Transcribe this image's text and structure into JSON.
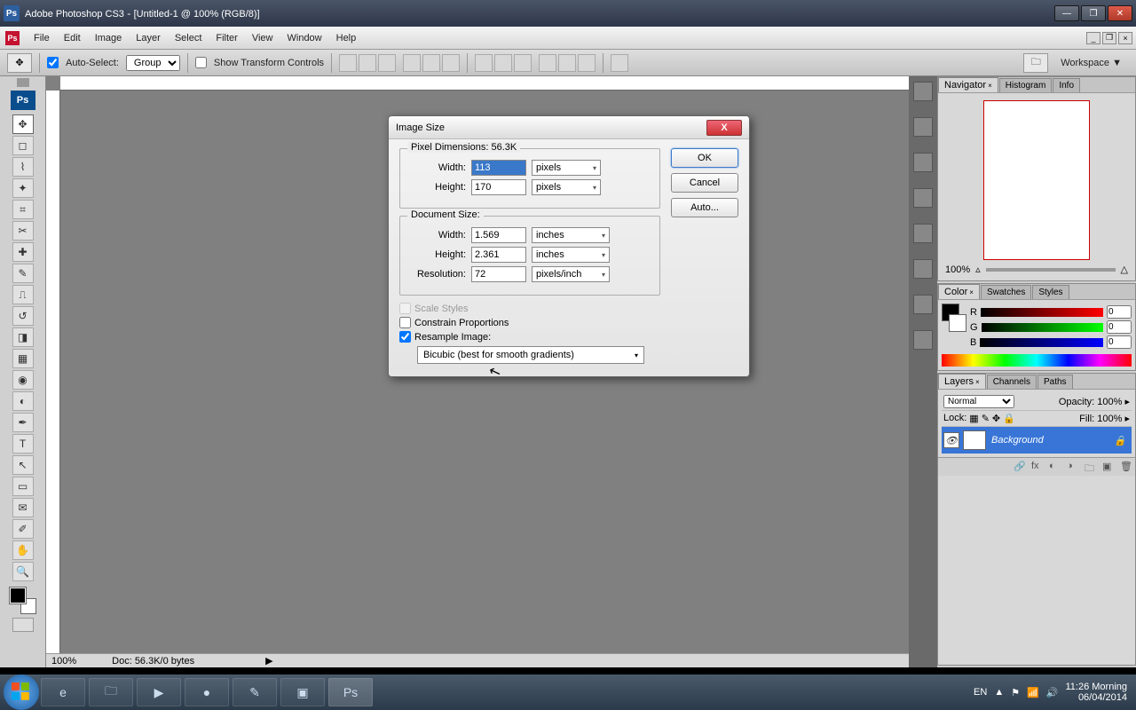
{
  "titlebar": {
    "app": "Adobe Photoshop CS3",
    "doc": "[Untitled-1 @ 100% (RGB/8)]"
  },
  "menu": [
    "File",
    "Edit",
    "Image",
    "Layer",
    "Select",
    "Filter",
    "View",
    "Window",
    "Help"
  ],
  "options": {
    "auto_select": "Auto-Select:",
    "group": "Group",
    "show_transform": "Show Transform Controls",
    "workspace": "Workspace"
  },
  "status": {
    "zoom": "100%",
    "doc": "Doc: 56.3K/0 bytes"
  },
  "dialog": {
    "title": "Image Size",
    "pixel_legend": "Pixel Dimensions:  56.3K",
    "width_l": "Width:",
    "height_l": "Height:",
    "res_l": "Resolution:",
    "px_w": "113",
    "px_h": "170",
    "px_unit": "pixels",
    "doc_legend": "Document Size:",
    "doc_w": "1.569",
    "doc_h": "2.361",
    "doc_unit": "inches",
    "res": "72",
    "res_unit": "pixels/inch",
    "scale": "Scale Styles",
    "constrain": "Constrain Proportions",
    "resample": "Resample Image:",
    "method": "Bicubic (best for smooth gradients)",
    "ok": "OK",
    "cancel": "Cancel",
    "auto": "Auto..."
  },
  "nav": {
    "tab1": "Navigator",
    "tab2": "Histogram",
    "tab3": "Info",
    "zoom": "100%"
  },
  "color": {
    "tab1": "Color",
    "tab2": "Swatches",
    "tab3": "Styles",
    "r": "R",
    "g": "G",
    "b": "B",
    "rv": "0",
    "gv": "0",
    "bv": "0"
  },
  "layers": {
    "tab1": "Layers",
    "tab2": "Channels",
    "tab3": "Paths",
    "blend": "Normal",
    "opacity_l": "Opacity:",
    "opacity": "100%",
    "lock_l": "Lock:",
    "fill_l": "Fill:",
    "fill": "100%",
    "bg": "Background"
  },
  "taskbar": {
    "lang": "EN",
    "time": "11:26 Morning",
    "date": "06/04/2014"
  }
}
